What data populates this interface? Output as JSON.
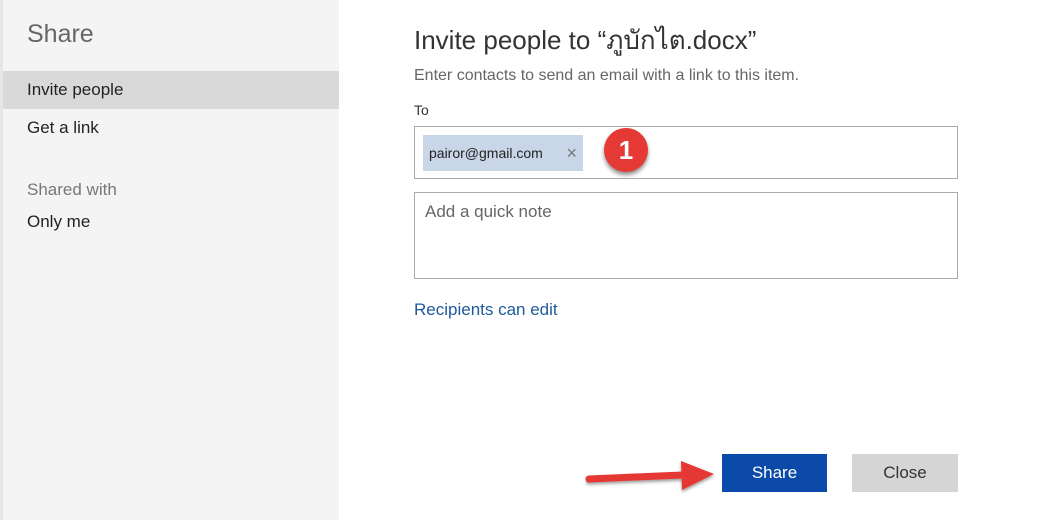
{
  "sidebar": {
    "title": "Share",
    "items": [
      {
        "label": "Invite people",
        "active": true
      },
      {
        "label": "Get a link",
        "active": false
      }
    ],
    "shared_with_heading": "Shared with",
    "shared_with_value": "Only me"
  },
  "main": {
    "title": "Invite people to “ภูบักไต.docx”",
    "subtitle": "Enter contacts to send an email with a link to this item.",
    "to_label": "To",
    "recipient": "pairor@gmail.com",
    "chip_remove": "×",
    "note_placeholder": "Add a quick note",
    "permission_link": "Recipients can edit"
  },
  "buttons": {
    "share": "Share",
    "close": "Close"
  },
  "annotation": {
    "badge_number": "1",
    "color": "#e53935"
  },
  "colors": {
    "accent": "#0b4aa8",
    "link": "#1e5a9a",
    "chip": "#c8d6e8"
  }
}
